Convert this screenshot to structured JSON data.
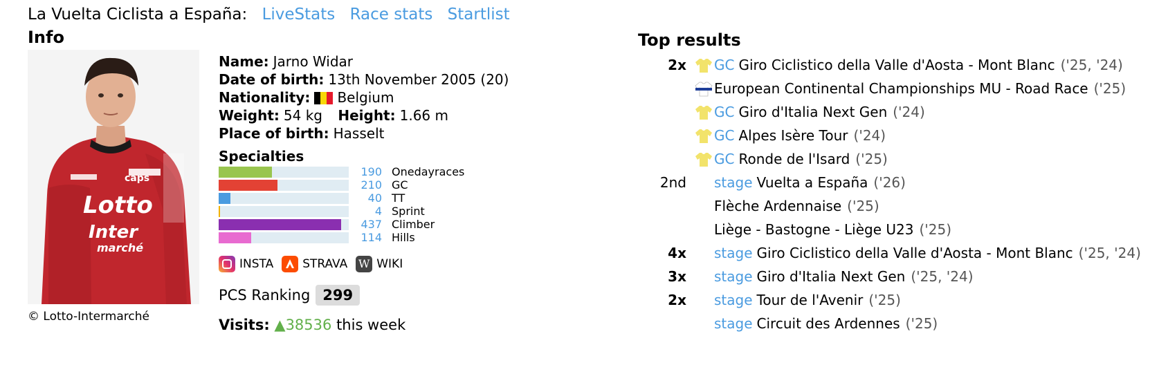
{
  "header": {
    "race_title": "La Vuelta Ciclista a España:",
    "links": [
      "LiveStats",
      "Race stats",
      "Startlist"
    ]
  },
  "info": {
    "heading": "Info",
    "photo_credit": "© Lotto-Intermarché",
    "name_label": "Name:",
    "name": "Jarno Widar",
    "dob_label": "Date of birth:",
    "dob": "13th November 2005 (20)",
    "nationality_label": "Nationality:",
    "nationality": "Belgium",
    "weight_label": "Weight:",
    "weight": "54 kg",
    "height_label": "Height:",
    "height": "1.66 m",
    "pob_label": "Place of birth:",
    "pob": "Hasselt"
  },
  "specialties": {
    "heading": "Specialties",
    "items": [
      {
        "value": "190",
        "label": "Onedayraces",
        "color": "#99c54e",
        "fraction": 0.41
      },
      {
        "value": "210",
        "label": "GC",
        "color": "#e34234",
        "fraction": 0.45
      },
      {
        "value": "40",
        "label": "TT",
        "color": "#4a9be0",
        "fraction": 0.09
      },
      {
        "value": "4",
        "label": "Sprint",
        "color": "#f2b200",
        "fraction": 0.01
      },
      {
        "value": "437",
        "label": "Climber",
        "color": "#8a2fb0",
        "fraction": 0.94
      },
      {
        "value": "114",
        "label": "Hills",
        "color": "#e86bd0",
        "fraction": 0.25
      }
    ]
  },
  "social": {
    "insta": "INSTA",
    "strava": "STRAVA",
    "wiki": "WIKI"
  },
  "ranking": {
    "label": "PCS Ranking",
    "value": "299"
  },
  "visits": {
    "label": "Visits:",
    "arrow": "▲",
    "count": "38536",
    "suffix": "this week"
  },
  "top_results": {
    "heading": "Top results",
    "items": [
      {
        "count": "2x",
        "jersey": "yellow",
        "type": "GC",
        "race": "Giro Ciclistico della Valle d'Aosta - Mont Blanc",
        "years": "('25, '24)"
      },
      {
        "count": "",
        "jersey": "blue",
        "type": "",
        "race": "European Continental Championships MU - Road Race",
        "years": "('25)"
      },
      {
        "count": "",
        "jersey": "yellow",
        "type": "GC",
        "race": "Giro d'Italia Next Gen",
        "years": "('24)"
      },
      {
        "count": "",
        "jersey": "yellow",
        "type": "GC",
        "race": "Alpes Isère Tour",
        "years": "('24)"
      },
      {
        "count": "",
        "jersey": "yellow",
        "type": "GC",
        "race": "Ronde de l'Isard",
        "years": "('25)"
      },
      {
        "count": "2nd",
        "rank": true,
        "jersey": "",
        "type": "stage",
        "race": "Vuelta a España",
        "years": "('26)"
      },
      {
        "count": "",
        "jersey": "",
        "type": "",
        "race": "Flèche Ardennaise",
        "years": "('25)"
      },
      {
        "count": "",
        "jersey": "",
        "type": "",
        "race": "Liège - Bastogne - Liège U23",
        "years": "('25)"
      },
      {
        "count": "4x",
        "jersey": "",
        "type": "stage",
        "race": "Giro Ciclistico della Valle d'Aosta - Mont Blanc",
        "years": "('25, '24)"
      },
      {
        "count": "3x",
        "jersey": "",
        "type": "stage",
        "race": "Giro d'Italia Next Gen",
        "years": "('25, '24)"
      },
      {
        "count": "2x",
        "jersey": "",
        "type": "stage",
        "race": "Tour de l'Avenir",
        "years": "('25)"
      },
      {
        "count": "",
        "jersey": "",
        "type": "stage",
        "race": "Circuit des Ardennes",
        "years": "('25)"
      }
    ]
  }
}
